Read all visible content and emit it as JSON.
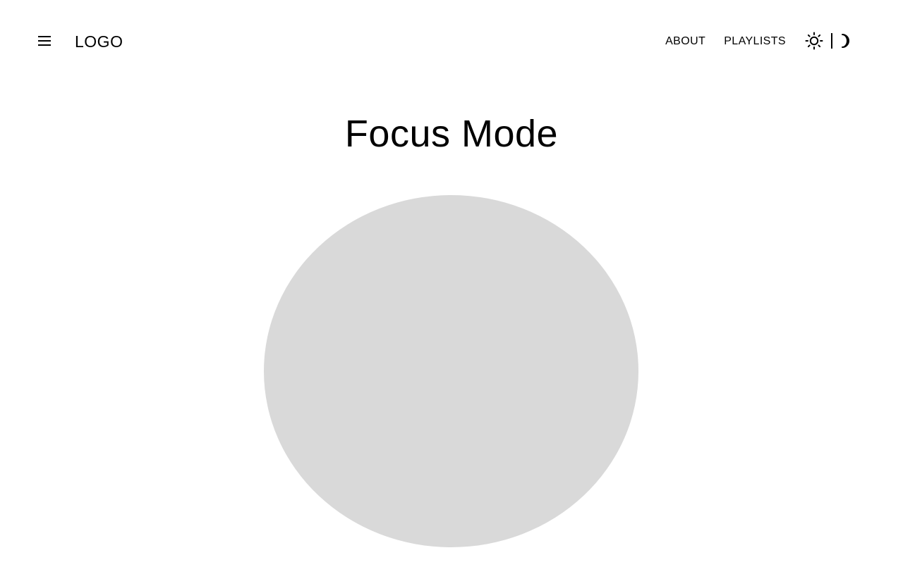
{
  "header": {
    "menu_icon": "hamburger-menu-icon",
    "logo_text": "LOGO",
    "nav": [
      {
        "label": "ABOUT"
      },
      {
        "label": "PLAYLISTS"
      }
    ],
    "theme_toggle": {
      "light_icon": "sun-icon",
      "dark_icon": "moon-icon"
    }
  },
  "main": {
    "title": "Focus Mode",
    "visual_color": "#d9d9d9"
  }
}
